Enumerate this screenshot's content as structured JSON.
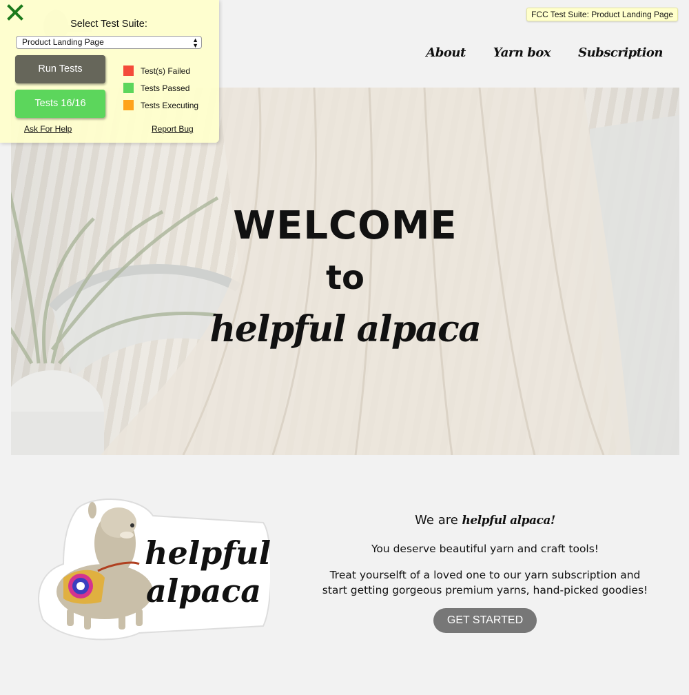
{
  "fcc_tag": "FCC Test Suite: Product Landing Page",
  "nav": {
    "items": [
      {
        "label": "About"
      },
      {
        "label": "Yarn box"
      },
      {
        "label": "Subscription"
      }
    ]
  },
  "hero": {
    "line1": "WELCOME",
    "line2": "to",
    "line3": "helpful alpaca"
  },
  "about": {
    "title_prefix": "We are ",
    "title_brand": "helpful alpaca!",
    "line1": "You deserve beautiful yarn and craft tools!",
    "line2": "Treat yourselft of a loved one to our yarn subscription and",
    "line3": "start getting gorgeous premium yarns, hand-picked goodies!",
    "cta": "GET STARTED",
    "sticker_text_1": "helpful",
    "sticker_text_2": "alpaca"
  },
  "test_panel": {
    "select_label": "Select Test Suite:",
    "selected_suite": "Product Landing Page",
    "run_button": "Run Tests",
    "tests_button": "Tests 16/16",
    "legend": [
      {
        "label": "Test(s) Failed",
        "color": "#f44b3a"
      },
      {
        "label": "Tests Passed",
        "color": "#5cd65c"
      },
      {
        "label": "Tests Executing",
        "color": "#ffa31a"
      }
    ],
    "help_link": "Ask For Help",
    "bug_link": "Report Bug"
  }
}
